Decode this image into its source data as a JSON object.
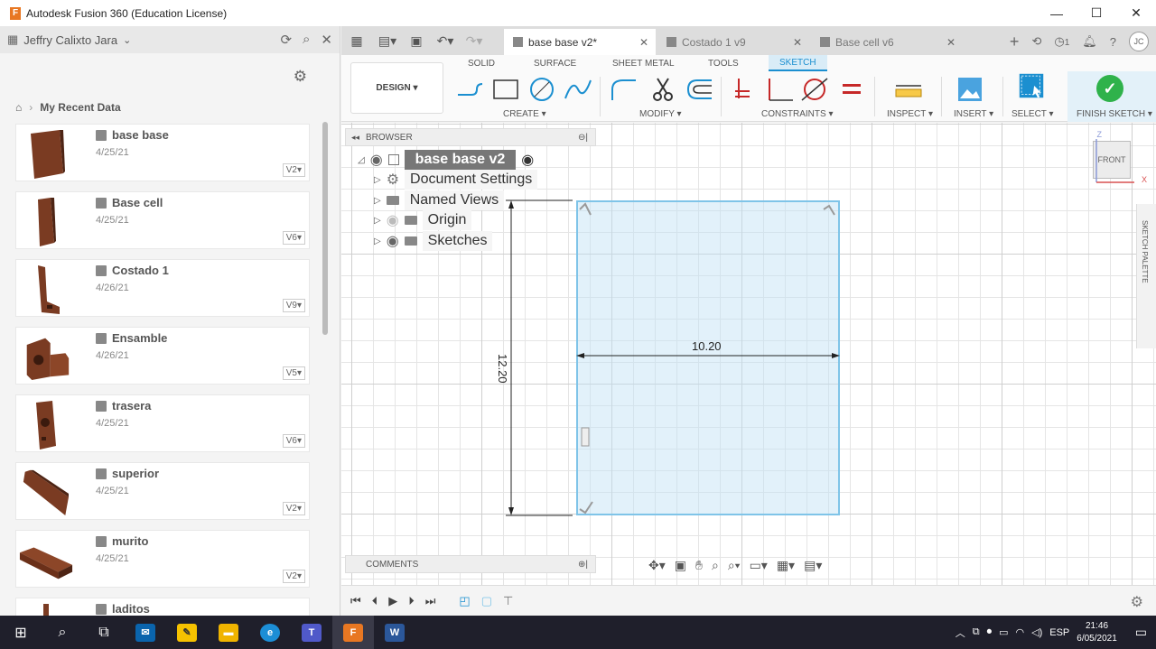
{
  "window": {
    "title": "Autodesk Fusion 360 (Education License)",
    "logo": "F"
  },
  "data_panel": {
    "user": "Jeffry Calixto Jara",
    "breadcrumb": "My Recent Data",
    "items": [
      {
        "name": "base base",
        "date": "4/25/21",
        "version": "V2▾"
      },
      {
        "name": "Base cell",
        "date": "4/25/21",
        "version": "V6▾"
      },
      {
        "name": "Costado 1",
        "date": "4/26/21",
        "version": "V9▾"
      },
      {
        "name": "Ensamble",
        "date": "4/26/21",
        "version": "V5▾"
      },
      {
        "name": "trasera",
        "date": "4/25/21",
        "version": "V6▾"
      },
      {
        "name": "superior",
        "date": "4/25/21",
        "version": "V2▾"
      },
      {
        "name": "murito",
        "date": "4/25/21",
        "version": "V2▾"
      },
      {
        "name": "laditos",
        "date": "",
        "version": ""
      }
    ]
  },
  "doc_tabs": [
    {
      "label": "base base v2*",
      "active": true
    },
    {
      "label": "Costado 1 v9",
      "active": false
    },
    {
      "label": "Base cell v6",
      "active": false
    }
  ],
  "toolbar": {
    "workspace": "DESIGN ▾",
    "tabs": [
      "SOLID",
      "SURFACE",
      "SHEET METAL",
      "TOOLS",
      "SKETCH"
    ],
    "groups": [
      "CREATE ▾",
      "MODIFY ▾",
      "CONSTRAINTS ▾",
      "INSPECT ▾",
      "INSERT ▾",
      "SELECT ▾",
      "FINISH SKETCH ▾"
    ],
    "notifications_count": "1",
    "avatar": "JC"
  },
  "browser": {
    "title": "BROWSER",
    "root": "base base v2",
    "nodes": [
      "Document Settings",
      "Named Views",
      "Origin",
      "Sketches"
    ]
  },
  "sketch": {
    "width_dim": "10.20",
    "height_dim": "12.20"
  },
  "comments": {
    "title": "COMMENTS"
  },
  "viewcube": {
    "face": "FRONT",
    "z_axis": "Z",
    "x_axis": "X"
  },
  "sketch_palette": {
    "label": "SKETCH PALETTE"
  },
  "taskbar": {
    "language": "ESP",
    "time": "21:46",
    "date": "6/05/2021"
  }
}
